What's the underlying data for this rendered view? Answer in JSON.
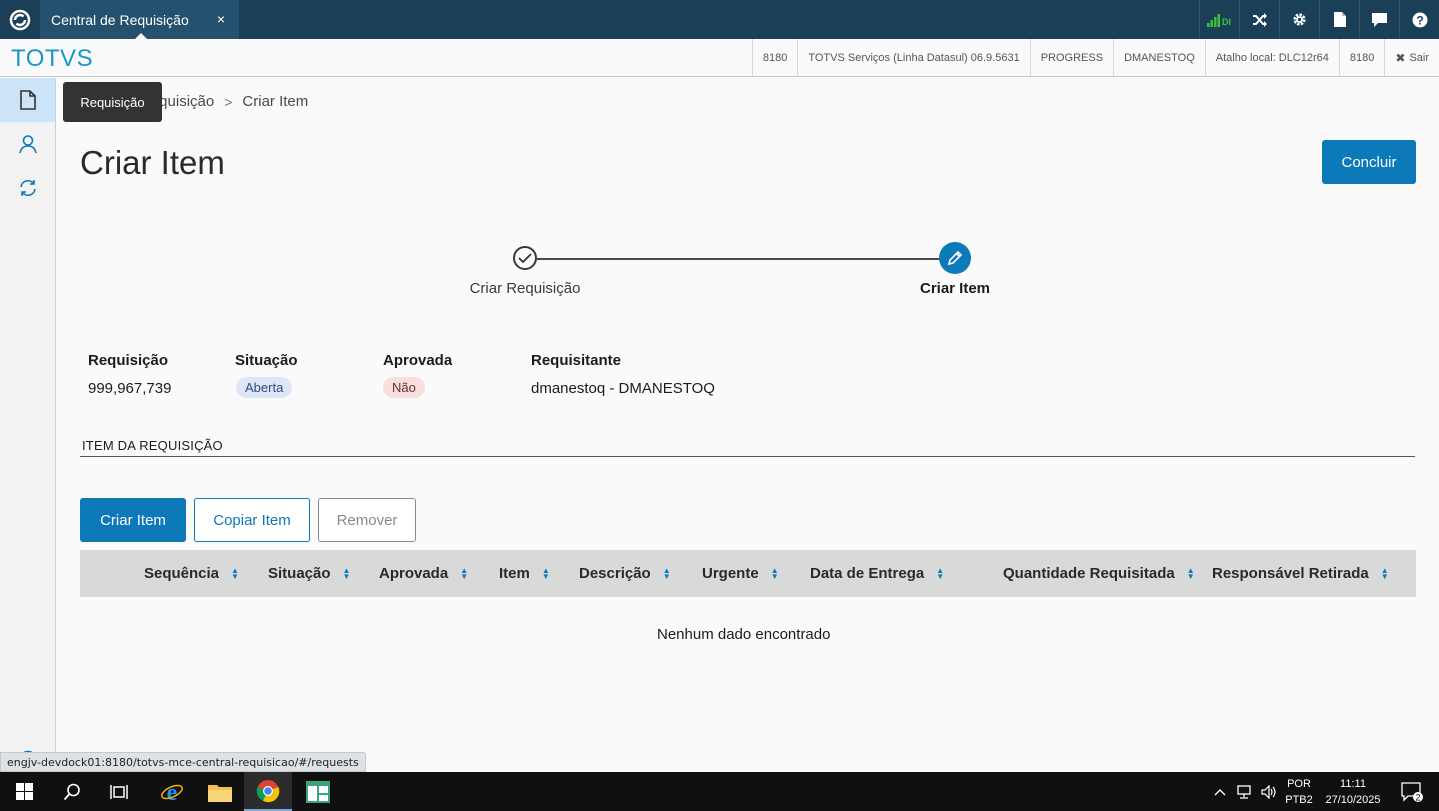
{
  "topbar": {
    "tab_title": "Central de Requisição",
    "tab_close": "×",
    "signal_label": "DI"
  },
  "brandbar": {
    "brand": "TOTVS",
    "info": [
      "8180",
      "TOTVS Serviços (Linha Datasul) 06.9.5631",
      "PROGRESS",
      "DMANESTOQ",
      "Atalho local: DLC12r64",
      "8180"
    ],
    "exit_label": "Sair"
  },
  "sidebar": {
    "tooltip": "Requisição"
  },
  "breadcrumb": {
    "parent": "Requisição",
    "current": "Criar Item"
  },
  "page": {
    "title": "Criar Item",
    "conclude_button": "Concluir"
  },
  "stepper": {
    "steps": [
      {
        "label": "Criar Requisição",
        "status": "done"
      },
      {
        "label": "Criar Item",
        "status": "active"
      }
    ]
  },
  "info": {
    "requisicao_label": "Requisição",
    "requisicao_value": "999,967,739",
    "situacao_label": "Situação",
    "situacao_value": "Aberta",
    "aprovada_label": "Aprovada",
    "aprovada_value": "Não",
    "requisitante_label": "Requisitante",
    "requisitante_value": "dmanestoq - DMANESTOQ"
  },
  "section": {
    "title": "ITEM DA REQUISIÇÃO"
  },
  "actions": {
    "create": "Criar Item",
    "copy": "Copiar Item",
    "remove": "Remover"
  },
  "table": {
    "columns": [
      "Sequência",
      "Situação",
      "Aprovada",
      "Item",
      "Descrição",
      "Urgente",
      "Data de Entrega",
      "Quantidade Requisitada",
      "Responsável Retirada"
    ],
    "empty_text": "Nenhum dado encontrado"
  },
  "status_url": "engjv-devdock01:8180/totvs-mce-central-requisicao/#/requests",
  "taskbar": {
    "lang_top": "POR",
    "lang_bottom": "PTB2",
    "time": "11:11",
    "date": "27/10/2025",
    "notifications": "2"
  },
  "colors": {
    "primary": "#0c79b9",
    "topbar": "#1b3f57",
    "brand": "#1a97c8"
  }
}
